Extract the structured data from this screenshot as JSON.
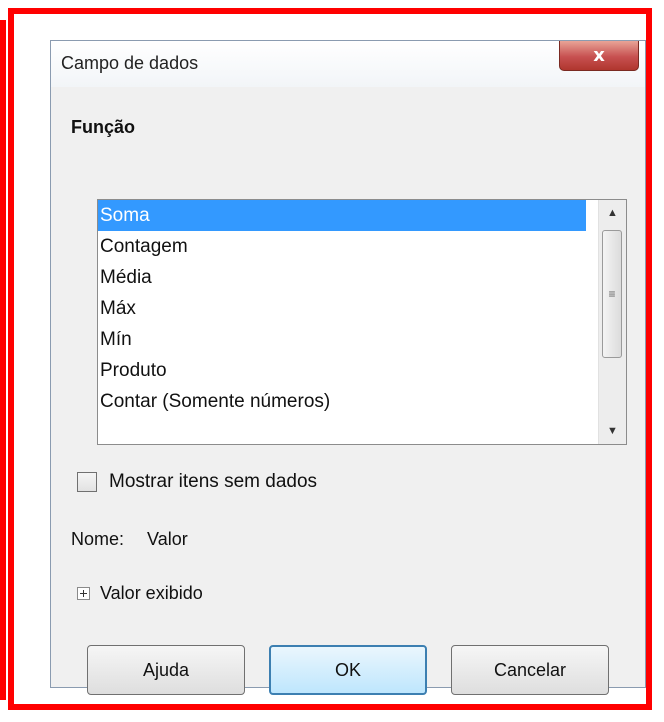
{
  "dialog": {
    "title": "Campo de dados",
    "close_label": "x"
  },
  "function_section": {
    "label": "Função",
    "items": [
      {
        "label": "Soma",
        "selected": true
      },
      {
        "label": "Contagem",
        "selected": false
      },
      {
        "label": "Média",
        "selected": false
      },
      {
        "label": "Máx",
        "selected": false
      },
      {
        "label": "Mín",
        "selected": false
      },
      {
        "label": "Produto",
        "selected": false
      },
      {
        "label": "Contar (Somente números)",
        "selected": false
      }
    ]
  },
  "show_items": {
    "label": "Mostrar itens sem dados",
    "checked": false
  },
  "name_row": {
    "label": "Nome:",
    "value": "Valor"
  },
  "displayed_value": {
    "label": "Valor exibido"
  },
  "buttons": {
    "help": "Ajuda",
    "ok": "OK",
    "cancel": "Cancelar"
  },
  "colors": {
    "highlight_frame": "#ff0000",
    "selection": "#3399ff",
    "close_button": "#c75050"
  }
}
